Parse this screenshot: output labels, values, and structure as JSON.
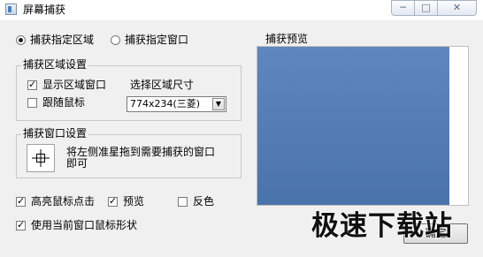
{
  "window": {
    "title": "屏幕捕获",
    "minimize_glyph": "─",
    "maximize_glyph": "□",
    "close_glyph": "✕"
  },
  "capture_mode": {
    "specified_area": {
      "label": "捕获指定区域",
      "selected": true
    },
    "specified_window": {
      "label": "捕获指定窗口",
      "selected": false
    }
  },
  "area_settings": {
    "title": "捕获区域设置",
    "show_area_window": {
      "label": "显示区域窗口",
      "checked": true
    },
    "follow_mouse": {
      "label": "跟随鼠标",
      "checked": false
    },
    "size_label": "选择区域尺寸",
    "size_value": "774x234(三菱)"
  },
  "window_settings": {
    "title": "捕获窗口设置",
    "hint": "将左侧准星拖到需要捕获的窗口即可"
  },
  "options": {
    "highlight_click": {
      "label": "高亮鼠标点击",
      "checked": true
    },
    "preview": {
      "label": "预览",
      "checked": true
    },
    "invert": {
      "label": "反色",
      "checked": false
    },
    "use_window_cursor": {
      "label": "使用当前窗口鼠标形状",
      "checked": true
    }
  },
  "preview_panel": {
    "title": "捕获预览",
    "fill_color": "#5a81b8"
  },
  "buttons": {
    "ok": "确定"
  },
  "watermark": "极速下载站",
  "icons": {
    "app": "app-window-icon",
    "check": "✓",
    "combo_arrow": "▼"
  }
}
